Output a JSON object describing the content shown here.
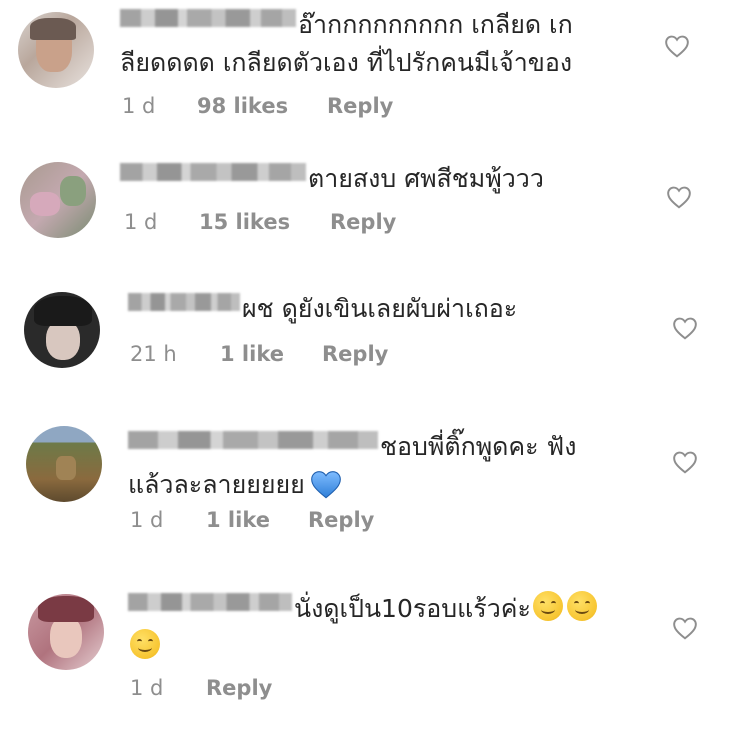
{
  "comments": [
    {
      "text_line1": "อ๊ากกกกกกกกก เกลียด เก",
      "text_line2": "ลียดดดด เกลียดตัวเอง ที่ไปรักคนมีเจ้าของ",
      "time": "1 d",
      "likes": "98 likes",
      "reply": "Reply"
    },
    {
      "text_line1": "ตายสงบ ศพสีชมพู้ววว",
      "time": "1 d",
      "likes": "15 likes",
      "reply": "Reply"
    },
    {
      "text_line1": "ผช ดูยังเขินเลยผับผ่าเถอะ",
      "time": "21 h",
      "likes": "1 like",
      "reply": "Reply"
    },
    {
      "text_line1": "ชอบพี่ติ๊กพูดคะ ฟัง",
      "text_line2": "แล้วละลายยยยย",
      "time": "1 d",
      "likes": "1 like",
      "reply": "Reply"
    },
    {
      "text_line1": "นั่งดูเป็น10รอบแร้วค่ะ",
      "time": "1 d",
      "reply": "Reply"
    }
  ],
  "icons": {
    "heart": "heart-outline-icon",
    "blue_heart": "blue-heart-emoji",
    "smile": "smiling-face-emoji"
  },
  "colors": {
    "text": "#262626",
    "meta": "#8e8e8e",
    "blue_heart": "#3b8de6",
    "emoji": "#f7c531"
  }
}
